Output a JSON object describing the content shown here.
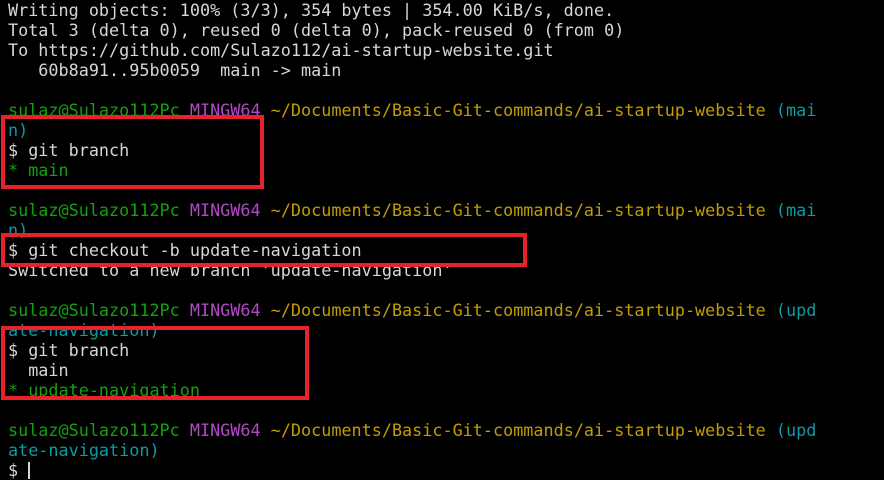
{
  "terminal": {
    "push_output": [
      "Writing objects: 100% (3/3), 354 bytes | 354.00 KiB/s, done.",
      "Total 3 (delta 0), reused 0 (delta 0), pack-reused 0 (from 0)",
      "To https://github.com/Sulazo112/ai-startup-website.git",
      "   60b8a91..95b0059  main -> main"
    ],
    "prompt_user": "sulaz@Sulazo112Pc",
    "prompt_env": "MINGW64",
    "prompt_path": "~/Documents/Basic-Git-commands/ai-startup-website",
    "prompts": [
      {
        "branch_wrap_1": "(mai",
        "branch_wrap_2": "n)"
      },
      {
        "branch_wrap_1": "(mai",
        "branch_wrap_2": "n)"
      },
      {
        "branch_wrap_1": "(upd",
        "branch_wrap_2": "ate-navigation)"
      },
      {
        "branch_wrap_1": "(upd",
        "branch_wrap_2": "ate-navigation)"
      }
    ],
    "commands": [
      "$ git branch",
      "$ git checkout -b update-navigation",
      "$ git branch",
      "$ "
    ],
    "branch_list_1": [
      "* main"
    ],
    "checkout_output": "Switched to a new branch 'update-navigation'",
    "branch_list_2": [
      "  main",
      "* update-navigation"
    ]
  },
  "colors": {
    "background": "#000000",
    "text": "#d6d6d6",
    "user_host": "#13a10e",
    "env": "#b148c6",
    "path": "#c19c00",
    "branch": "#0c9aa3",
    "annotation": "#e8222a"
  }
}
